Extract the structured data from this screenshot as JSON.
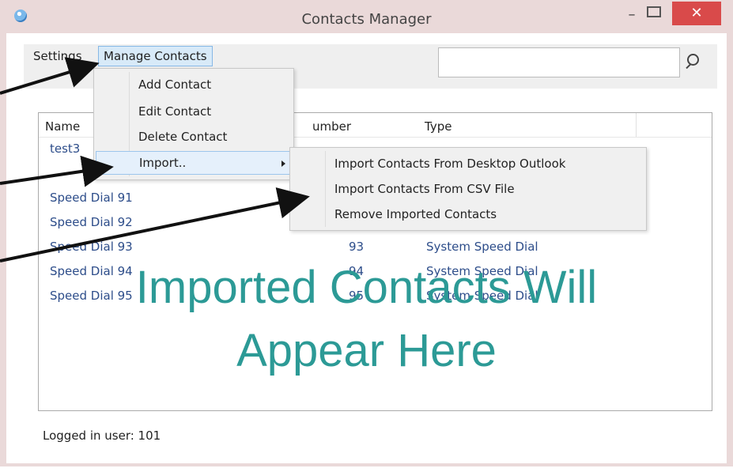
{
  "window": {
    "title": "Contacts Manager",
    "minimize_label": "–",
    "close_label": "✕"
  },
  "menu": {
    "settings": "Settings",
    "manage_contacts": "Manage Contacts"
  },
  "search": {
    "placeholder": "",
    "icon": "search-icon"
  },
  "dropdown": {
    "items": [
      {
        "label": "Add Contact"
      },
      {
        "label": "Edit Contact"
      },
      {
        "label": "Delete Contact"
      },
      {
        "label": "Import.."
      }
    ]
  },
  "submenu": {
    "items": [
      {
        "label": "Import Contacts From Desktop Outlook"
      },
      {
        "label": "Import Contacts From CSV File"
      },
      {
        "label": "Remove Imported Contacts"
      }
    ]
  },
  "table": {
    "columns": [
      "Name",
      "umber",
      "Type"
    ],
    "rows": [
      {
        "name": "test3",
        "number": "",
        "type": ""
      },
      {
        "name": "",
        "number": "",
        "type": ""
      },
      {
        "name": "Speed Dial 91",
        "number": "",
        "type": ""
      },
      {
        "name": "Speed Dial 92",
        "number": "",
        "type": ""
      },
      {
        "name": "Speed Dial 93",
        "number": "93",
        "type": "System Speed Dial"
      },
      {
        "name": "Speed Dial 94",
        "number": "94",
        "type": "System Speed Dial"
      },
      {
        "name": "Speed Dial 95",
        "number": "95",
        "type": "System Speed Dial"
      }
    ]
  },
  "status": {
    "logged_in": "Logged in user: 101"
  },
  "overlay": {
    "line1": "Imported Contacts Will",
    "line2": "Appear Here"
  },
  "colors": {
    "overlay_text": "#2c9a96",
    "link_text": "#2d4d8a",
    "close_button": "#d94a4a",
    "menu_highlight": "#d8eaf8"
  }
}
